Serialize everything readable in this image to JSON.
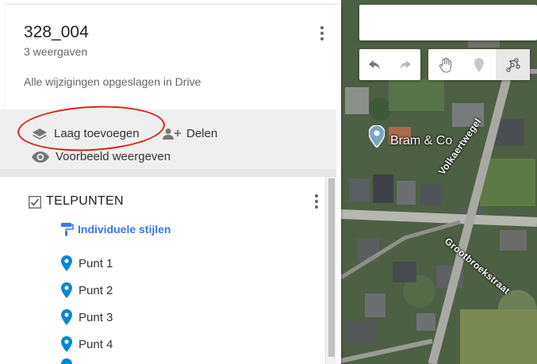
{
  "map_panel": {
    "title": "328_004",
    "views": "3 weergaven",
    "save_status": "Alle wijzigingen opgeslagen in Drive",
    "actions": {
      "add_layer": "Laag toevoegen",
      "share": "Delen",
      "preview": "Voorbeeld weergeven"
    }
  },
  "layer": {
    "title": "TELPUNTEN",
    "checked": true,
    "style_link": "Individuele stijlen",
    "points": [
      "Punt 1",
      "Punt 2",
      "Punt 3",
      "Punt 4"
    ]
  },
  "map": {
    "place_label": "Bram & Co",
    "streets": [
      "Volkaertwegel",
      "Grootbroekstraat"
    ],
    "toolbar": [
      "undo-icon",
      "redo-icon",
      "hand-icon",
      "marker-icon",
      "draw-line-icon"
    ]
  },
  "colors": {
    "accent_blue": "#3b78e7",
    "pin_blue": "#0288d1",
    "annotation_red": "#e0201b",
    "actions_bg": "#efefef"
  }
}
